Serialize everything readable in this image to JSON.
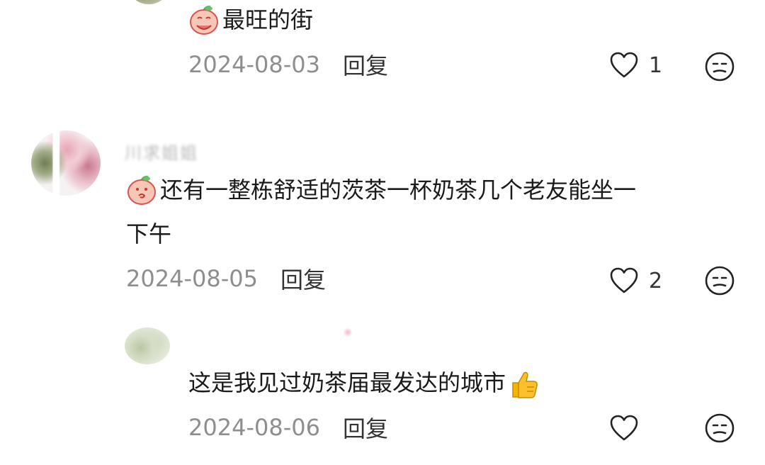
{
  "comments": [
    {
      "text": "最旺的街",
      "date": "2024-08-03",
      "reply_label": "回复",
      "likes": "1",
      "emoji_icon": "peach-face-icon"
    },
    {
      "author_blurred": "川求姐姐",
      "text_line1": "还有一整栋舒适的茨茶一杯奶茶几个老友能坐一",
      "text_line2": "下午",
      "date": "2024-08-05",
      "reply_label": "回复",
      "likes": "2",
      "emoji_icon": "peach-face-icon"
    },
    {
      "text": "这是我见过奶茶届最发达的城市",
      "date": "2024-08-06",
      "reply_label": "回复",
      "likes": "",
      "emoji_icon": "thumbs-up-icon"
    }
  ],
  "colors": {
    "text": "#1a1a1a",
    "meta": "#8e8e8e",
    "icon": "#222222"
  }
}
